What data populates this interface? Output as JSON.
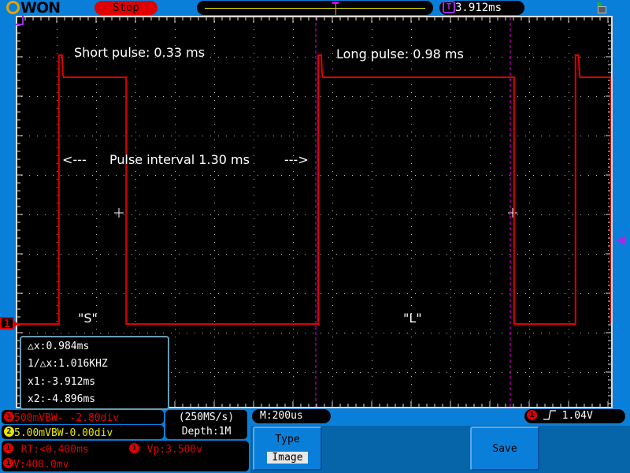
{
  "topbar": {
    "brand": "WON",
    "run_state": "Stop",
    "trigger_position": "3.912ms"
  },
  "annotations": {
    "short_pulse": "Short pulse: 0.33 ms",
    "long_pulse": "Long pulse: 0.98 ms",
    "interval_left_arrow": "<---",
    "interval_text": "Pulse interval 1.30 ms",
    "interval_right_arrow": "--->",
    "label_s": "\"S\"",
    "label_l": "\"L\""
  },
  "channel_marker": "1",
  "cursor_readout": {
    "delta_x": "△x:0.984ms",
    "inv_delta_x": "1/△x:1.016KHZ",
    "x1": "x1:-3.912ms",
    "x2": "x2:-4.896ms"
  },
  "status": {
    "ch1_badge": "1",
    "ch1": "500mVBW- -2.80div",
    "ch2_badge": "2",
    "ch2": "5.00mVBW-0.00div",
    "sample_rate": "(250MS/s)",
    "depth": "Depth:1M",
    "timebase": "M:200us",
    "trigger_badge": "1",
    "trigger_edge": "rising-edge",
    "trigger_level": "1.04V",
    "measurements": [
      {
        "badge": "1",
        "text": "RT:<0.400ms"
      },
      {
        "badge": "1",
        "text": "Vp:3.500v"
      },
      {
        "badge": "1",
        "text": "V:400.0mv"
      }
    ]
  },
  "menu": {
    "type_label": "Type",
    "type_value": "Image",
    "save_label": "Save"
  },
  "colors": {
    "frame": "#0a7fd9",
    "ch1": "#e00000",
    "ch2": "#e6e600",
    "cursor": "#e000e0",
    "trigger": "#9c2fe6"
  },
  "waveform": {
    "units": "divisions",
    "segments": [
      {
        "state": "low",
        "from_div": 0.0,
        "to_div": 1.05
      },
      {
        "state": "high",
        "from_div": 1.05,
        "to_div": 2.75,
        "name": "short pulse"
      },
      {
        "state": "low",
        "from_div": 2.75,
        "to_div": 7.6
      },
      {
        "state": "high",
        "from_div": 7.6,
        "to_div": 12.55,
        "name": "long pulse"
      },
      {
        "state": "low",
        "from_div": 12.55,
        "to_div": 14.1
      },
      {
        "state": "high",
        "from_div": 14.1,
        "to_div": 15.0
      }
    ],
    "high_level_div": 1.0,
    "low_level_div": 7.8
  }
}
